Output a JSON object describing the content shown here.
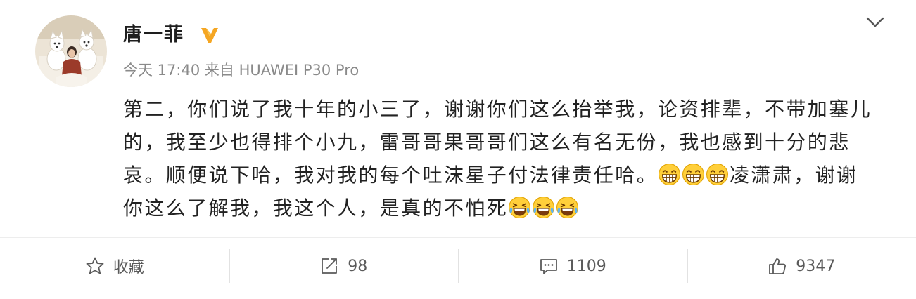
{
  "post": {
    "author": "唐一菲",
    "avatar": "avatar-photo",
    "verified_icon": "verified-badge-icon",
    "menu_icon": "chevron-down-icon",
    "time": "今天 17:40",
    "source": "来自 HUAWEI P30 Pro",
    "body": {
      "lines": [
        {
          "text": "第二，你们说了我十年的小三了，谢谢你们这么抬举我，论资排辈，不带加塞儿"
        },
        {
          "text": "的，我至少也得排个小九，雷哥哥果哥哥们这么有名无份，我也感到十分的悲"
        },
        {
          "before": "哀。顺便说下哈，我对我的每个吐沫星子付法律责任哈。",
          "emojis": [
            "laughing-emoji",
            "laughing-emoji",
            "laughing-emoji"
          ],
          "after": "凌潇肃，谢谢"
        },
        {
          "before": "你这么了解我，我这个人，是真的不怕死",
          "emojis": [
            "tears-of-joy-emoji",
            "tears-of-joy-emoji",
            "tears-of-joy-emoji"
          ]
        }
      ]
    }
  },
  "actions": [
    {
      "icon": "star-icon",
      "label": "收藏"
    },
    {
      "icon": "repost-icon",
      "label": "98"
    },
    {
      "icon": "comment-icon",
      "label": "1109"
    },
    {
      "icon": "thumbs-up-icon",
      "label": "9347"
    }
  ],
  "colors": {
    "verified": "#f5a623",
    "text": "#222222",
    "meta": "#8a8a8a",
    "action_text": "#5a5a5a",
    "emoji_face": "#ffcf3a"
  }
}
